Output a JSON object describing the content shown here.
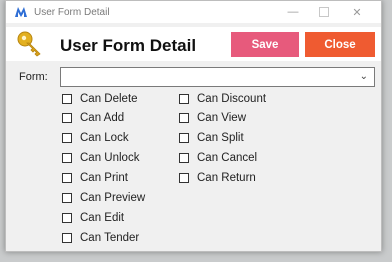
{
  "window": {
    "title": "User Form Detail",
    "controls": {
      "minimize": "—",
      "close": "✕"
    }
  },
  "header": {
    "heading": "User Form Detail",
    "save_label": "Save",
    "close_label": "Close"
  },
  "form": {
    "label": "Form:",
    "value": ""
  },
  "permissions": {
    "left": [
      {
        "label": "Can Delete",
        "checked": false
      },
      {
        "label": "Can Add",
        "checked": false
      },
      {
        "label": "Can Lock",
        "checked": false
      },
      {
        "label": "Can Unlock",
        "checked": false
      },
      {
        "label": "Can Print",
        "checked": false
      },
      {
        "label": "Can Preview",
        "checked": false
      },
      {
        "label": "Can Edit",
        "checked": false
      },
      {
        "label": "Can Tender",
        "checked": false
      }
    ],
    "right": [
      {
        "label": "Can Discount",
        "checked": false
      },
      {
        "label": "Can View",
        "checked": false
      },
      {
        "label": "Can Split",
        "checked": false
      },
      {
        "label": "Can Cancel",
        "checked": false
      },
      {
        "label": "Can Return",
        "checked": false
      }
    ]
  },
  "colors": {
    "save": "#e75a7c",
    "close": "#ef5b31"
  }
}
